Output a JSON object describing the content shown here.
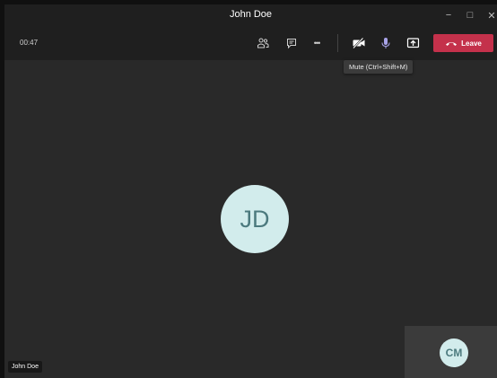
{
  "window": {
    "title": "John Doe",
    "minimize_glyph": "−",
    "maximize_glyph": "□",
    "close_glyph": "✕"
  },
  "toolbar": {
    "timer": "00:47",
    "icons": [
      "participants-icon",
      "chat-icon",
      "more-options-icon",
      "camera-off-icon",
      "microphone-icon",
      "share-screen-icon"
    ],
    "more_glyph": "•••",
    "leave_label": "Leave",
    "leave_color": "#c4314b",
    "mic_accent": "#a8a3e8"
  },
  "tooltip": {
    "text": "Mute (Ctrl+Shift+M)"
  },
  "stage": {
    "main_initials": "JD",
    "name_label": "John Doe",
    "self_initials": "CM",
    "avatar_bg": "#d2ecec",
    "avatar_fg": "#4c7a7e"
  }
}
